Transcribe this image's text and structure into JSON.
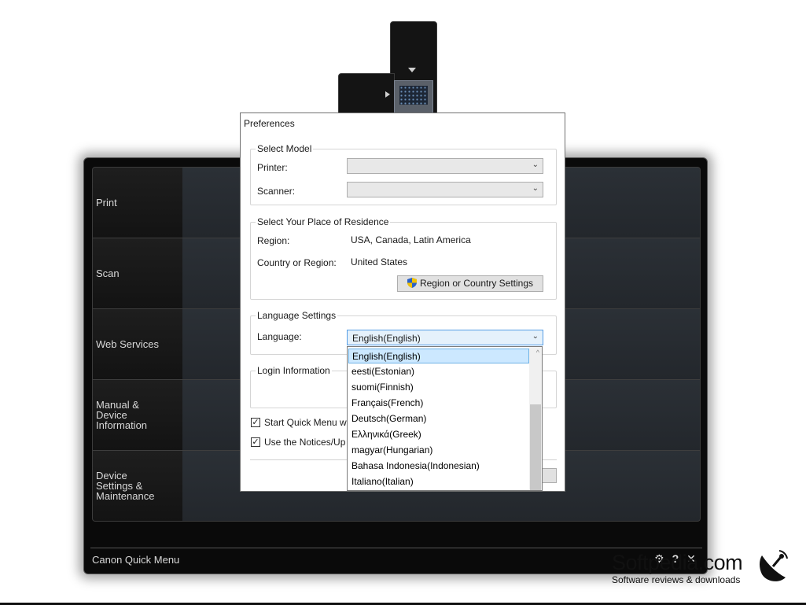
{
  "quick_menu": {
    "items": [
      {
        "label": "Print"
      },
      {
        "label": "Scan"
      },
      {
        "label": "Web Services"
      },
      {
        "label": "Manual &\nDevice\nInformation"
      },
      {
        "label": "Device\nSettings &\nMaintenance"
      }
    ],
    "title": "Canon Quick Menu",
    "icons": [
      "settings-icon",
      "help-icon",
      "close-icon"
    ]
  },
  "dialog": {
    "title": "Preferences",
    "model": {
      "group_title": "Select Model",
      "printer_label": "Printer:",
      "printer_value": "",
      "scanner_label": "Scanner:",
      "scanner_value": ""
    },
    "residence": {
      "group_title": "Select Your Place of Residence",
      "region_label": "Region:",
      "region_value": "USA, Canada, Latin America",
      "country_label": "Country or Region:",
      "country_value": "United States",
      "settings_button": "Region or Country Settings"
    },
    "language": {
      "group_title": "Language Settings",
      "label": "Language:",
      "value": "English(English)",
      "options": [
        "English(English)",
        "eesti(Estonian)",
        "suomi(Finnish)",
        "Français(French)",
        "Deutsch(German)",
        "Ελληνικά(Greek)",
        "magyar(Hungarian)",
        "Bahasa Indonesia(Indonesian)",
        "Italiano(Italian)"
      ],
      "selected_index": 0
    },
    "login": {
      "group_title": "Login Information"
    },
    "checkboxes": [
      {
        "label": "Start Quick Menu w",
        "checked": true
      },
      {
        "label": "Use the Notices/Up",
        "checked": true
      }
    ]
  },
  "watermark": {
    "brand": "Softpedia.com",
    "tagline": "Software reviews & downloads"
  }
}
